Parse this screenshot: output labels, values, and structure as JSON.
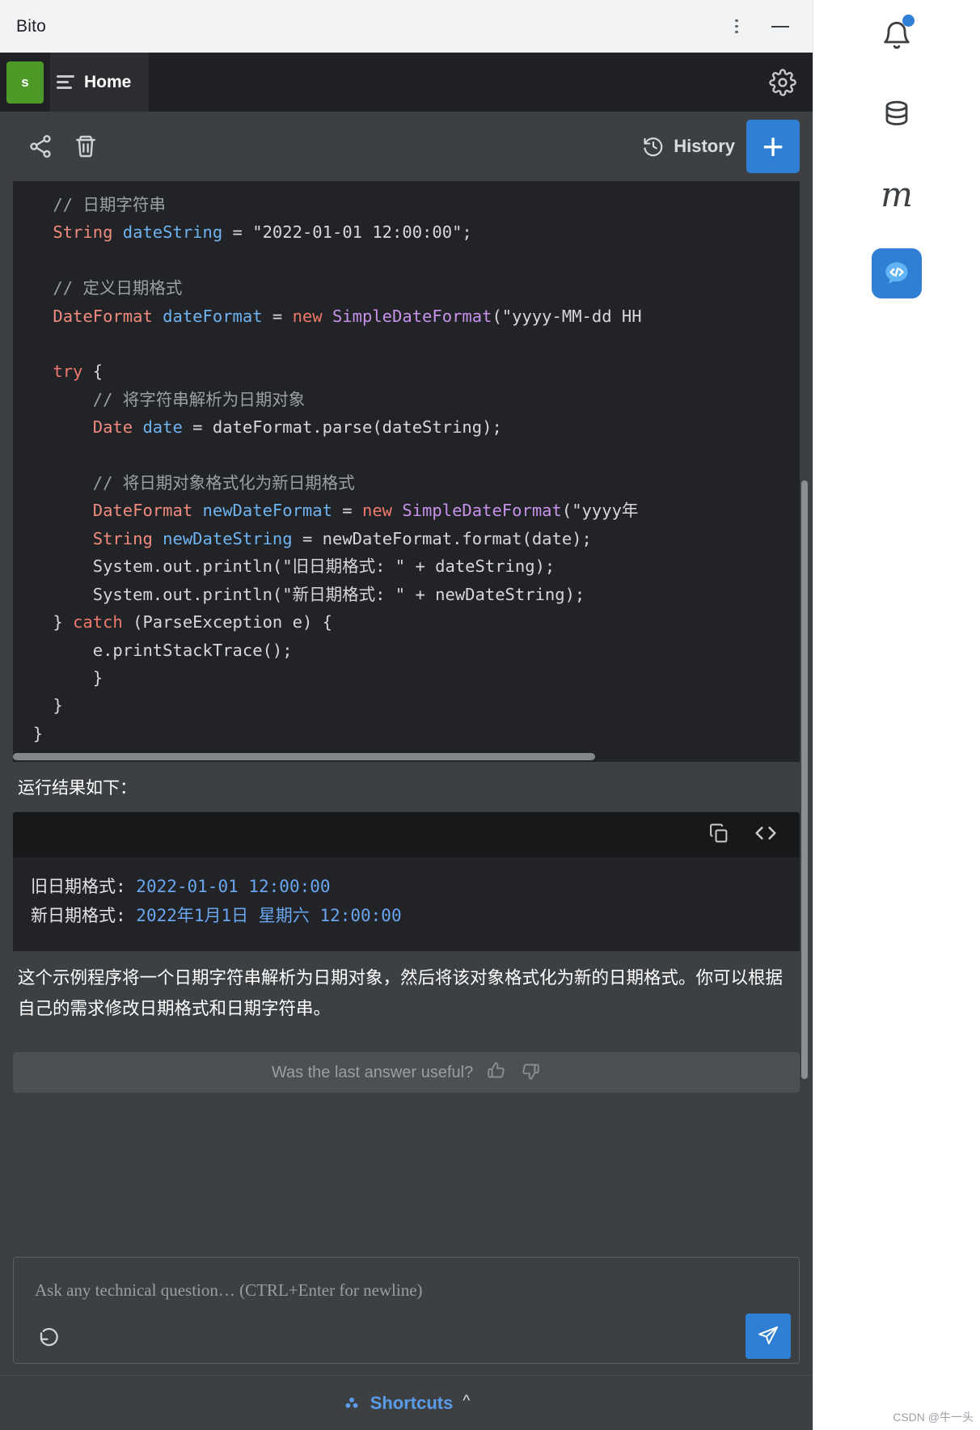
{
  "window": {
    "app_title": "Bito",
    "menu_icon": "kebab-menu-icon",
    "minimize_icon": "minimize-icon"
  },
  "tabbar": {
    "avatar_initial": "s",
    "tab_label": "Home",
    "settings_icon": "gear-icon"
  },
  "toolbar": {
    "share_icon": "share-icon",
    "delete_icon": "trash-icon",
    "history_label": "History",
    "history_icon": "clock-rewind-icon",
    "new_chat_label": "+"
  },
  "conversation": {
    "code_block": {
      "language": "java",
      "lines": [
        {
          "indent": 4,
          "tokens": [
            {
              "t": "// 日期字符串",
              "c": "k-cmt"
            }
          ]
        },
        {
          "indent": 4,
          "tokens": [
            {
              "t": "String",
              "c": "k-type"
            },
            {
              "t": " ",
              "c": "k-txt"
            },
            {
              "t": "dateString",
              "c": "k-var"
            },
            {
              "t": " = ",
              "c": "k-txt"
            },
            {
              "t": "\"2022-01-01 12:00:00\";",
              "c": "k-str"
            }
          ]
        },
        {
          "indent": 0,
          "tokens": []
        },
        {
          "indent": 4,
          "tokens": [
            {
              "t": "// 定义日期格式",
              "c": "k-cmt"
            }
          ]
        },
        {
          "indent": 4,
          "tokens": [
            {
              "t": "DateFormat",
              "c": "k-type"
            },
            {
              "t": " ",
              "c": "k-txt"
            },
            {
              "t": "dateFormat",
              "c": "k-var"
            },
            {
              "t": " = ",
              "c": "k-txt"
            },
            {
              "t": "new",
              "c": "k-kw"
            },
            {
              "t": " ",
              "c": "k-txt"
            },
            {
              "t": "SimpleDateFormat",
              "c": "k-cls"
            },
            {
              "t": "(\"yyyy-MM-dd HH",
              "c": "k-txt"
            }
          ]
        },
        {
          "indent": 0,
          "tokens": []
        },
        {
          "indent": 4,
          "tokens": [
            {
              "t": "try",
              "c": "k-kw"
            },
            {
              "t": " {",
              "c": "k-txt"
            }
          ]
        },
        {
          "indent": 8,
          "tokens": [
            {
              "t": "// 将字符串解析为日期对象",
              "c": "k-cmt"
            }
          ]
        },
        {
          "indent": 8,
          "tokens": [
            {
              "t": "Date",
              "c": "k-type"
            },
            {
              "t": " ",
              "c": "k-txt"
            },
            {
              "t": "date",
              "c": "k-var"
            },
            {
              "t": " = dateFormat.parse(dateString);",
              "c": "k-txt"
            }
          ]
        },
        {
          "indent": 0,
          "tokens": []
        },
        {
          "indent": 8,
          "tokens": [
            {
              "t": "// 将日期对象格式化为新日期格式",
              "c": "k-cmt"
            }
          ]
        },
        {
          "indent": 8,
          "tokens": [
            {
              "t": "DateFormat",
              "c": "k-type"
            },
            {
              "t": " ",
              "c": "k-txt"
            },
            {
              "t": "newDateFormat",
              "c": "k-var"
            },
            {
              "t": " = ",
              "c": "k-txt"
            },
            {
              "t": "new",
              "c": "k-kw"
            },
            {
              "t": " ",
              "c": "k-txt"
            },
            {
              "t": "SimpleDateFormat",
              "c": "k-cls"
            },
            {
              "t": "(\"yyyy年",
              "c": "k-txt"
            }
          ]
        },
        {
          "indent": 8,
          "tokens": [
            {
              "t": "String",
              "c": "k-type"
            },
            {
              "t": " ",
              "c": "k-txt"
            },
            {
              "t": "newDateString",
              "c": "k-var"
            },
            {
              "t": " = newDateFormat.format(date);",
              "c": "k-txt"
            }
          ]
        },
        {
          "indent": 8,
          "tokens": [
            {
              "t": "System.out.println(\"旧日期格式: \" + dateString);",
              "c": "k-txt"
            }
          ]
        },
        {
          "indent": 8,
          "tokens": [
            {
              "t": "System.out.println(\"新日期格式: \" + newDateString);",
              "c": "k-txt"
            }
          ]
        },
        {
          "indent": 4,
          "tokens": [
            {
              "t": "} ",
              "c": "k-txt"
            },
            {
              "t": "catch",
              "c": "k-kw"
            },
            {
              "t": " (ParseException e) {",
              "c": "k-txt"
            }
          ]
        },
        {
          "indent": 8,
          "tokens": [
            {
              "t": "e.printStackTrace();",
              "c": "k-txt"
            }
          ]
        },
        {
          "indent": 8,
          "tokens": [
            {
              "t": "}",
              "c": "k-txt"
            }
          ]
        },
        {
          "indent": 4,
          "tokens": [
            {
              "t": "}",
              "c": "k-txt"
            }
          ]
        },
        {
          "indent": 2,
          "tokens": [
            {
              "t": "}",
              "c": "k-txt"
            }
          ]
        }
      ]
    },
    "run_label": "运行结果如下：",
    "output_block": {
      "copy_icon": "copy-icon",
      "code_icon": "code-brackets-icon",
      "lines": [
        {
          "label": "旧日期格式: ",
          "value": "2022-01-01 12:00:00"
        },
        {
          "label": "新日期格式: ",
          "value": "2022年1月1日 星期六 12:00:00"
        }
      ]
    },
    "explanation": "这个示例程序将一个日期字符串解析为日期对象，然后将该对象格式化为新的日期格式。你可以根据自己的需求修改日期格式和日期字符串。",
    "feedback": {
      "question": "Was the last answer useful?",
      "thumbs_up_icon": "thumbs-up-icon",
      "thumbs_down_icon": "thumbs-down-icon"
    }
  },
  "composer": {
    "placeholder": "Ask any technical question… (CTRL+Enter for newline)",
    "value": "",
    "undo_icon": "undo-arrow-icon",
    "send_icon": "send-paper-plane-icon"
  },
  "footer": {
    "shortcuts_label": "Shortcuts",
    "shortcuts_icon": "shortcuts-blocks-icon",
    "caret_icon": "chevron-up-icon"
  },
  "rail": {
    "items": [
      {
        "name": "notifications-icon",
        "badge": true
      },
      {
        "name": "database-icon",
        "badge": false
      },
      {
        "name": "letter-m-icon",
        "label": "m",
        "badge": false
      },
      {
        "name": "bito-chat-icon",
        "active": true,
        "badge": false
      }
    ]
  },
  "watermark": "CSDN @牛一头",
  "colors": {
    "accent": "#2f7fd4",
    "avatar": "#4e9a28",
    "code_bg": "#212327",
    "panel_bg": "#3c4043",
    "output_value": "#6aa6f0"
  }
}
